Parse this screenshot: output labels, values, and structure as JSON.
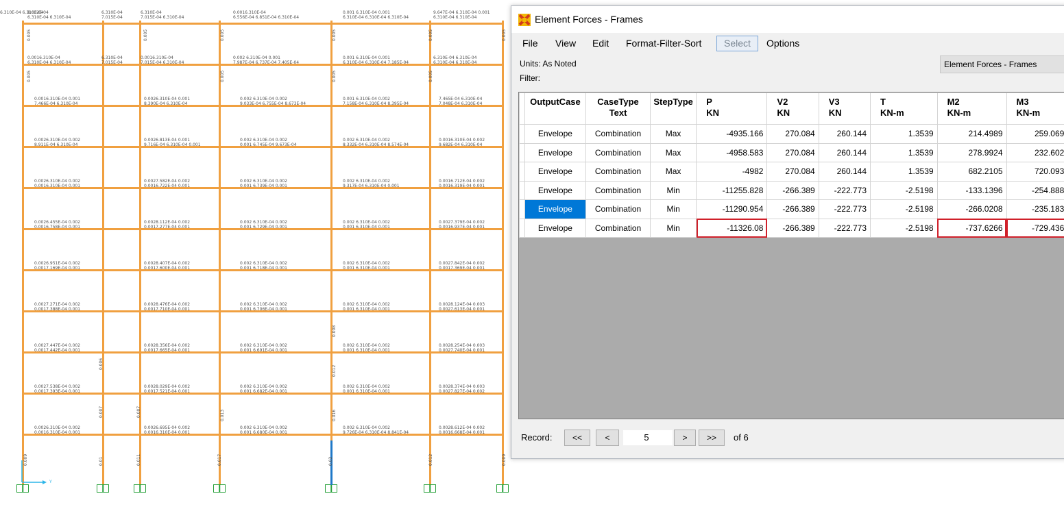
{
  "model": {
    "row_labels": [
      [
        "8.632E-04",
        "6.310E-04",
        "6.310E-04",
        "0.0016.310E-04",
        "0.001  6.310E-04  0.001",
        "9.647E-04 6.310E-04  0.001",
        "6.310E-04 6.310E-04"
      ],
      [
        "6.310E-04 6.310E-04",
        "7.015E-04",
        "7.015E-04 6.310E-04",
        "6.556E-04 6.851E-04 6.310E-04",
        "6.310E-04 6.310E-04 6.310E-04",
        "6.310E-04 6.310E-04"
      ],
      [
        "0.0016.310E-04",
        "6.310E-04",
        "0.0016.310E-04",
        "0.002  6.310E-04  0.001",
        "0.001  6.310E-04  0.001",
        "6.310E-04 6.310E-04"
      ],
      [
        "6.310E-04 6.310E-04",
        "7.015E-04",
        "7.015E-04 6.310E-04",
        "7.987E-04 6.737E-04 7.405E-04",
        "6.310E-04 6.310E-04 7.185E-04",
        "6.310E-04 6.310E-04"
      ],
      [
        "0.0016.310E-04 0.001",
        "0.0026.310E-04 0.001",
        "0.002  6.310E-04  0.002",
        "0.001  6.310E-04  0.002",
        "7.465E-04 6.310E-04"
      ],
      [
        "7.466E-04 6.310E-04",
        "8.390E-04 6.310E-04",
        "9.033E-04 6.755E-04 8.673E-04",
        "7.158E-04 6.310E-04 8.395E-04",
        "7.048E-04 6.310E-04"
      ],
      [
        "0.0026.310E-04 0.002",
        "0.0026.813E-04 0.001",
        "0.002  6.310E-04  0.002",
        "0.002  6.310E-04  0.002",
        "0.0016.310E-04 0.002"
      ],
      [
        "8.911E-04 6.310E-04",
        "9.716E-04 6.310E-04 0.001",
        "0.001  6.745E-04 9.673E-04",
        "8.332E-04 6.310E-04 8.574E-04",
        "9.682E-04 6.310E-04"
      ],
      [
        "0.0026.310E-04 0.002",
        "0.0027.582E-04 0.002",
        "0.002  6.310E-04  0.002",
        "0.002  6.310E-04  0.002",
        "0.0016.712E-04 0.002"
      ],
      [
        "0.0016.310E-04 0.001",
        "0.0016.722E-04 0.001",
        "0.001  6.739E-04  0.001",
        "9.317E-04 6.310E-04  0.001",
        "0.0016.319E-04 0.001"
      ],
      [
        "0.0026.455E-04 0.002",
        "0.0028.112E-04 0.002",
        "0.002  6.310E-04  0.002",
        "0.002  6.310E-04  0.002",
        "0.0027.379E-04 0.002"
      ],
      [
        "0.0016.758E-04 0.001",
        "0.0017.277E-04 0.001",
        "0.001  6.729E-04  0.001",
        "0.001  6.310E-04  0.001",
        "0.0016.937E-04 0.001"
      ],
      [
        "0.0026.951E-04 0.002",
        "0.0028.407E-04 0.002",
        "0.002  6.310E-04  0.002",
        "0.002  6.310E-04  0.002",
        "0.0027.842E-04 0.002"
      ],
      [
        "0.0017.169E-04 0.001",
        "0.0017.600E-04 0.001",
        "0.001  6.718E-04  0.001",
        "0.001  6.310E-04  0.001",
        "0.0017.369E-04 0.001"
      ],
      [
        "0.0027.271E-04 0.002",
        "0.0028.476E-04 0.002",
        "0.002  6.310E-04  0.002",
        "0.002  6.310E-04  0.002",
        "0.0028.124E-04 0.003"
      ],
      [
        "0.0017.388E-04 0.001",
        "0.0017.710E-04 0.001",
        "0.001  6.706E-04  0.001",
        "0.001  6.310E-04  0.001",
        "0.0027.613E-04 0.001"
      ],
      [
        "0.0027.447E-04 0.002",
        "0.0028.356E-04 0.002",
        "0.002  6.310E-04  0.002",
        "0.002  6.310E-04  0.002",
        "0.0028.254E-04 0.003"
      ],
      [
        "0.0017.442E-04 0.001",
        "0.0017.665E-04 0.001",
        "0.001  6.691E-04  0.001",
        "0.001  6.310E-04  0.001",
        "0.0027.740E-04 0.001"
      ],
      [
        "0.0027.538E-04 0.002",
        "0.0028.029E-04 0.002",
        "0.002  6.310E-04  0.002",
        "0.002  6.310E-04  0.002",
        "0.0028.374E-04 0.003"
      ],
      [
        "0.0017.393E-04 0.001",
        "0.0017.521E-04 0.001",
        "0.001  6.682E-04  0.001",
        "0.001  6.310E-04  0.001",
        "0.0027.827E-04 0.002"
      ],
      [
        "0.0026.310E-04 0.002",
        "0.0026.695E-04 0.002",
        "0.002  6.310E-04  0.002",
        "0.002  6.310E-04  0.002",
        "0.0028.612E-04 0.002"
      ],
      [
        "0.0016.310E-04 0.001",
        "0.0016.310E-04 0.001",
        "0.001  6.680E-04  0.001",
        "9.726E-04 6.310E-04 8.841E-04",
        "0.0016.668E-04 0.001"
      ]
    ],
    "column_labels": [
      "0.005",
      "0.006",
      "0.007",
      "0.008",
      "0.009",
      "0.01",
      "0.011",
      "0.012",
      "0.013",
      "0.016",
      "0.017",
      "0.02"
    ],
    "axis_label": "Y",
    "colors": {
      "frame": "#f0a040",
      "selected": "#1e78c8",
      "support": "#27a13a"
    }
  },
  "dialog": {
    "title": "Element Forces - Frames",
    "menu": [
      "File",
      "View",
      "Edit",
      "Format-Filter-Sort",
      "Select",
      "Options"
    ],
    "units": "Units:  As Noted",
    "filter": "Filter:",
    "table_name": "Element Forces - Frames",
    "columns": [
      {
        "l1": "OutputCase",
        "l2": ""
      },
      {
        "l1": "CaseType",
        "l2": "Text"
      },
      {
        "l1": "StepType",
        "l2": ""
      },
      {
        "l1": "P",
        "l2": "KN"
      },
      {
        "l1": "V2",
        "l2": "KN"
      },
      {
        "l1": "V3",
        "l2": "KN"
      },
      {
        "l1": "T",
        "l2": "KN-m"
      },
      {
        "l1": "M2",
        "l2": "KN-m"
      },
      {
        "l1": "M3",
        "l2": "KN-m"
      }
    ],
    "rows": [
      [
        "Envelope",
        "Combination",
        "Max",
        "-4935.166",
        "270.084",
        "260.144",
        "1.3539",
        "214.4989",
        "259.0699"
      ],
      [
        "Envelope",
        "Combination",
        "Max",
        "-4958.583",
        "270.084",
        "260.144",
        "1.3539",
        "278.9924",
        "232.6026"
      ],
      [
        "Envelope",
        "Combination",
        "Max",
        "-4982",
        "270.084",
        "260.144",
        "1.3539",
        "682.2105",
        "720.0936"
      ],
      [
        "Envelope",
        "Combination",
        "Min",
        "-11255.828",
        "-266.389",
        "-222.773",
        "-2.5198",
        "-133.1396",
        "-254.8885"
      ],
      [
        "Envelope",
        "Combination",
        "Min",
        "-11290.954",
        "-266.389",
        "-222.773",
        "-2.5198",
        "-266.0208",
        "-235.1833"
      ],
      [
        "Envelope",
        "Combination",
        "Min",
        "-11326.08",
        "-266.389",
        "-222.773",
        "-2.5198",
        "-737.6266",
        "-729.4365"
      ]
    ],
    "record": {
      "label": "Record:",
      "first": "<<",
      "prev": "<",
      "current": "5",
      "next": ">",
      "last": ">>",
      "of": "of 6"
    },
    "colors": {
      "highlight": "#d0202a",
      "selection": "#0078d7",
      "grid_bg": "#ababab"
    }
  }
}
